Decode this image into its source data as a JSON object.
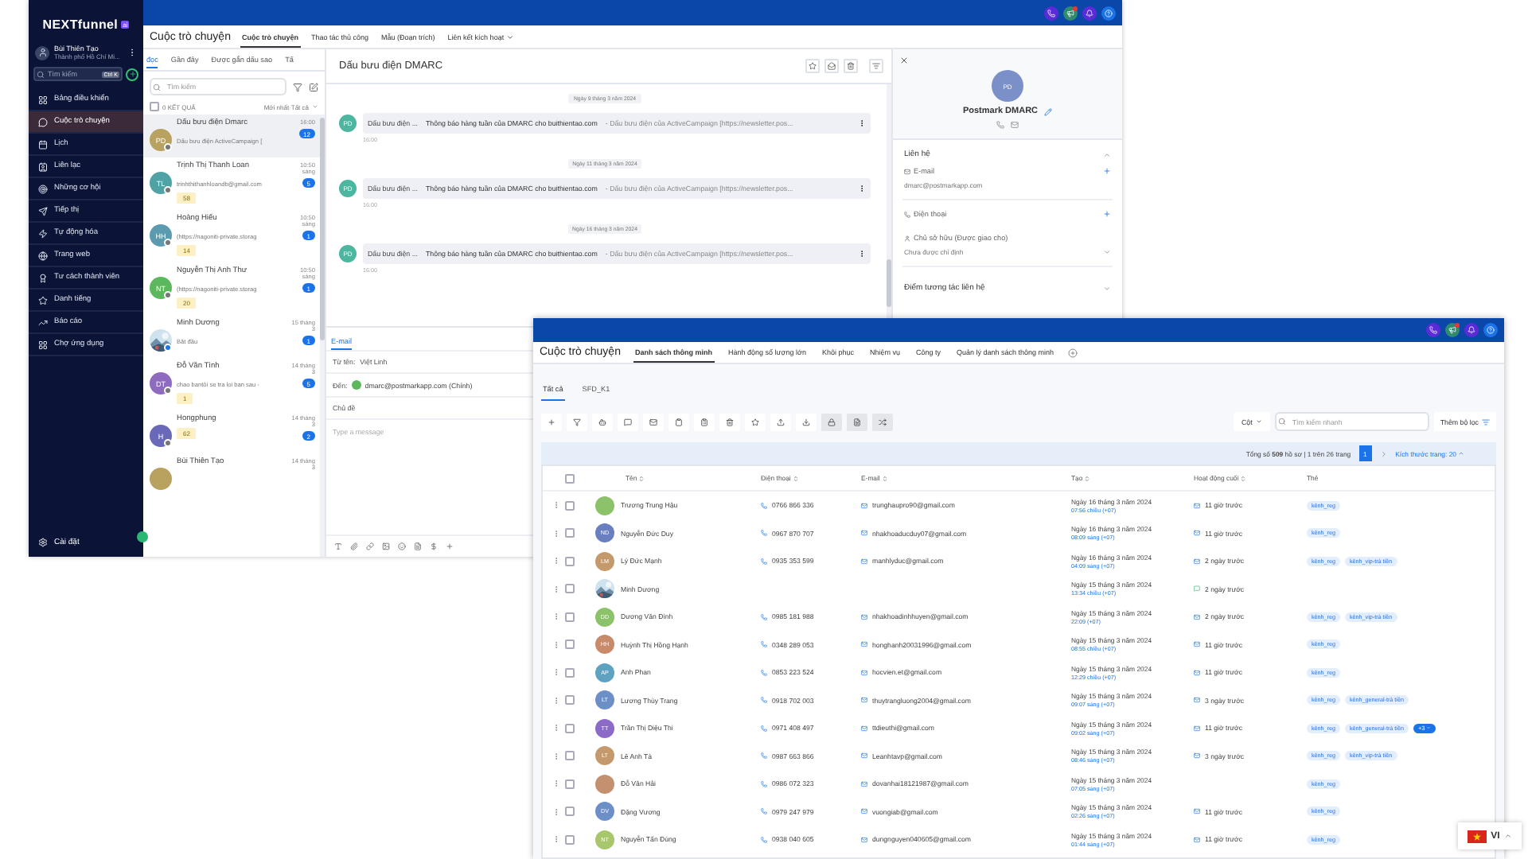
{
  "sidebar": {
    "logo": "NEXTfunnel",
    "logo_badge": "ai",
    "user": {
      "name": "Bùi Thiên Tạo",
      "location": "Thành phố Hồ Chí Mi..."
    },
    "search": {
      "placeholder": "Tìm kiếm",
      "shortcut": "Ctrl K"
    },
    "items": [
      {
        "label": "Bảng điều khiển",
        "selected": false
      },
      {
        "label": "Cuộc trò chuyện",
        "selected": true
      },
      {
        "label": "Lịch",
        "selected": false
      },
      {
        "label": "Liên lạc",
        "selected": false
      },
      {
        "label": "Những cơ hội",
        "selected": false
      },
      {
        "label": "Tiếp thị",
        "selected": false
      },
      {
        "label": "Tự động hóa",
        "selected": false
      },
      {
        "label": "Trang web",
        "selected": false
      },
      {
        "label": "Tư cách thành viên",
        "selected": false
      },
      {
        "label": "Danh tiếng",
        "selected": false
      },
      {
        "label": "Báo cáo",
        "selected": false
      },
      {
        "label": "Chợ ứng dụng",
        "selected": false
      }
    ],
    "settings": "Cài đặt"
  },
  "conversations_window": {
    "page_title": "Cuộc trò chuyện",
    "tabs": [
      {
        "label": "Cuộc trò chuyện",
        "selected": true,
        "dropdown": false
      },
      {
        "label": "Thao tác thủ công",
        "selected": false,
        "dropdown": false
      },
      {
        "label": "Mẫu (Đoạn trích)",
        "selected": false,
        "dropdown": false
      },
      {
        "label": "Liên kết kích hoạt",
        "selected": false,
        "dropdown": true
      }
    ],
    "filters": [
      {
        "label": "đọc",
        "selected": true
      },
      {
        "label": "Gần đây",
        "selected": false
      },
      {
        "label": "Được gắn dấu sao",
        "selected": false
      },
      {
        "label": "Tấ",
        "selected": false
      }
    ],
    "search": {
      "placeholder": "Tìm kiếm"
    },
    "select_all_checked": false,
    "result_count": "0 KẾT QUẢ",
    "sort": "Mới nhất·Tất cả",
    "conversations": [
      {
        "avatar": {
          "kind": "initials",
          "text": "PD",
          "color": "#b9a15f"
        },
        "kind": "email",
        "name": "Dấu bưu điện Dmarc",
        "time": "16:00",
        "snippet": "Dấu bưu điện ActiveCampaign [",
        "unread": "12",
        "selected": true
      },
      {
        "avatar": {
          "kind": "initials",
          "text": "TL",
          "color": "#4fa3a5"
        },
        "kind": "email",
        "name": "Trịnh Thị Thanh Loan",
        "time": "10:50 sáng",
        "snippet": "trinhthithanhloandb@gmail.com",
        "unread": "5",
        "tag": "58",
        "selected": false
      },
      {
        "avatar": {
          "kind": "initials",
          "text": "HH",
          "color": "#5b9bb0"
        },
        "kind": "email",
        "name": "Hoàng Hiếu",
        "time": "10:50 sáng",
        "snippet": "(https://nagoniti-private.storag",
        "unread": "1",
        "tag": "14",
        "selected": false
      },
      {
        "avatar": {
          "kind": "initials",
          "text": "NT",
          "color": "#5cb85c"
        },
        "kind": "email",
        "name": "Nguyễn Thị Anh Thư",
        "time": "10:50 sáng",
        "snippet": "(https://nagoniti-private.storag",
        "unread": "1",
        "tag": "20",
        "selected": false
      },
      {
        "avatar": {
          "kind": "picture"
        },
        "kind": "messenger",
        "name": "Minh Dương",
        "time": "15 tháng 3",
        "snippet": "Bắt đầu",
        "unread": "1",
        "selected": false
      },
      {
        "avatar": {
          "kind": "initials",
          "text": "DT",
          "color": "#8e6bbf"
        },
        "kind": "email",
        "name": "Đỗ Văn Tình",
        "time": "14 tháng 3",
        "snippet": "chao bantôi se tra loi ban sau -",
        "unread": "5",
        "tag": "1",
        "selected": false
      },
      {
        "avatar": {
          "kind": "initials",
          "text": "H",
          "color": "#6a68b8"
        },
        "kind": "email",
        "name": "Hongphung",
        "time": "14 tháng 3",
        "unread": "2",
        "tag": "62",
        "selected": false
      },
      {
        "avatar": {
          "kind": "blank",
          "color": "#b9a15f"
        },
        "name": "Bùi Thiên Tạo",
        "time": "14 tháng 3",
        "selected": false
      }
    ],
    "chat": {
      "title": "Dấu bưu điện DMARC",
      "messages": [
        {
          "date": "Ngày 9 tháng 3 năm 2024",
          "initials": "PD",
          "sender": "Dấu bưu điện ...",
          "subject": "Thông báo hàng tuần của DMARC cho buithientao.com",
          "preview": "- Dấu bưu điện của ActiveCampaign [https://newsletter.pos...",
          "time": "16:00"
        },
        {
          "date": "Ngày 11 tháng 3 năm 2024",
          "initials": "PD",
          "sender": "Dấu bưu điện ...",
          "subject": "Thông báo hàng tuần của DMARC cho buithientao.com",
          "preview": "- Dấu bưu điện của ActiveCampaign [https://newsletter.pos...",
          "time": "16:00"
        },
        {
          "date": "Ngày 16 tháng 3 năm 2024",
          "initials": "PD",
          "sender": "Dấu bưu điện ...",
          "subject": "Thông báo hàng tuần của DMARC cho buithientao.com",
          "preview": "- Dấu bưu điện của ActiveCampaign [https://newsletter.pos...",
          "time": "16:00"
        }
      ],
      "compose": {
        "tab": "E-mail",
        "from_label": "Từ tên:",
        "from": "Việt Linh",
        "to_label": "Đến:",
        "to": "dmarc@postmarkapp.com (Chính)",
        "subject_label": "Chủ đề",
        "placeholder": "Type a message"
      }
    },
    "contact": {
      "initials": "PD",
      "name": "Postmark DMARC",
      "contact_heading": "Liên hệ",
      "email_label": "E-mail",
      "email": "dmarc@postmarkapp.com",
      "phone_label": "Điện thoại",
      "owner_label": "Chủ sở hữu (Được giao cho)",
      "owner_value": "Chưa được chỉ định",
      "engagement_heading": "Điểm tương tác liên hệ"
    }
  },
  "contacts_window": {
    "page_title": "Cuộc trò chuyện",
    "tabs": [
      {
        "label": "Danh sách thông minh",
        "selected": true
      },
      {
        "label": "Hành động số lượng lớn",
        "selected": false
      },
      {
        "label": "Khôi phục",
        "selected": false
      },
      {
        "label": "Nhiệm vụ",
        "selected": false
      },
      {
        "label": "Công ty",
        "selected": false
      },
      {
        "label": "Quản lý danh sách thông minh",
        "selected": false
      }
    ],
    "subtabs": [
      {
        "label": "Tất cả",
        "selected": true
      },
      {
        "label": "SFD_K1",
        "selected": false
      }
    ],
    "columns_button": "Cột",
    "search": {
      "placeholder": "Tìm kiếm nhanh"
    },
    "filter_button": "Thêm bộ lọc",
    "pager": {
      "summary": "Tổng số **509** hồ sơ | 1 trên 26 trang",
      "pages": [
        {
          "label": "1",
          "selected": true
        }
      ],
      "page_size": "Kích thước trang: 20"
    },
    "table": {
      "all_checked": false,
      "columns": [
        "Tên",
        "Điện thoại",
        "E-mail",
        "Tạo",
        "Hoạt động cuối",
        "Thẻ"
      ],
      "rows": [
        {
          "checked": false,
          "avatar": {
            "kind": "blank",
            "color": "#8bc26a"
          },
          "name": "Trương Trung Hậu",
          "phone": "0766 866 336",
          "email": "trunghaupro90@gmail.com",
          "created_date": "Ngày 16 tháng 3 năm 2024",
          "created_time": "07:56 chiều (+07)",
          "activity": {
            "kind": "email",
            "text": "11 giờ trước"
          },
          "tags": [
            "kênh_reg"
          ]
        },
        {
          "checked": false,
          "avatar": {
            "kind": "initials",
            "text": "ND",
            "color": "#6a7fc0"
          },
          "name": "Nguyễn Đức Duy",
          "phone": "0967 870 707",
          "email": "nhakhoaducduy07@gmail.com",
          "created_date": "Ngày 16 tháng 3 năm 2024",
          "created_time": "08:09 sáng (+07)",
          "activity": {
            "kind": "email",
            "text": "11 giờ trước"
          },
          "tags": [
            "kênh_reg"
          ]
        },
        {
          "checked": false,
          "avatar": {
            "kind": "initials",
            "text": "LM",
            "color": "#c49a6c"
          },
          "name": "Lý Đức Mạnh",
          "phone": "0935 353 599",
          "email": "manhlyduc@gmail.com",
          "created_date": "Ngày 16 tháng 3 năm 2024",
          "created_time": "04:09 sáng (+07)",
          "activity": {
            "kind": "email",
            "text": "2 ngày trước"
          },
          "tags": [
            "kênh_reg",
            "kênh_vip-trả tiền"
          ]
        },
        {
          "checked": false,
          "avatar": {
            "kind": "picture"
          },
          "name": "Minh Dương",
          "created_date": "Ngày 15 tháng 3 năm 2024",
          "created_time": "13:34 chiều (+07)",
          "activity": {
            "kind": "chat",
            "text": "2 ngày trước"
          },
          "tags": []
        },
        {
          "checked": false,
          "avatar": {
            "kind": "initials",
            "text": "DD",
            "color": "#8bc26a"
          },
          "name": "Dương Văn Đình",
          "phone": "0985 181 988",
          "email": "nhakhoadinhhuyen@gmail.com",
          "created_date": "Ngày 15 tháng 3 năm 2024",
          "created_time": "22:09 (+07)",
          "activity": {
            "kind": "email",
            "text": "2 ngày trước"
          },
          "tags": [
            "kênh_reg",
            "kênh_vip-trả tiền"
          ]
        },
        {
          "checked": false,
          "avatar": {
            "kind": "initials",
            "text": "HH",
            "color": "#c98a6a"
          },
          "name": "Huỳnh Thị Hồng Hạnh",
          "phone": "0348 289 053",
          "email": "honghanh20031996@gmail.com",
          "created_date": "Ngày 15 tháng 3 năm 2024",
          "created_time": "08:55 chiều (+07)",
          "activity": {
            "kind": "email",
            "text": "11 giờ trước"
          },
          "tags": [
            "kênh_reg"
          ]
        },
        {
          "checked": false,
          "avatar": {
            "kind": "initials",
            "text": "AP",
            "color": "#5ea1c0"
          },
          "name": "Anh Phan",
          "phone": "0853 223 524",
          "email": "hocvien.et@gmail.com",
          "created_date": "Ngày 15 tháng 3 năm 2024",
          "created_time": "12:29 chiều (+07)",
          "activity": {
            "kind": "email",
            "text": "11 giờ trước"
          },
          "tags": [
            "kênh_reg"
          ]
        },
        {
          "checked": false,
          "avatar": {
            "kind": "initials",
            "text": "LT",
            "color": "#6d8fc7"
          },
          "name": "Lương Thùy Trang",
          "phone": "0918 702 003",
          "email": "thuytrangluong2004@gmail.com",
          "created_date": "Ngày 15 tháng 3 năm 2024",
          "created_time": "09:07 sáng (+07)",
          "activity": {
            "kind": "email",
            "text": "3 ngày trước"
          },
          "tags": [
            "kênh_reg",
            "kênh_general-trả tiền"
          ]
        },
        {
          "checked": false,
          "avatar": {
            "kind": "initials",
            "text": "TT",
            "color": "#8b6bc7"
          },
          "name": "Trần Thị Diệu Thi",
          "phone": "0971 408 497",
          "email": "ttdieuthi@gmail.com",
          "created_date": "Ngày 15 tháng 3 năm 2024",
          "created_time": "09:02 sáng (+07)",
          "activity": {
            "kind": "email",
            "text": "11 giờ trước"
          },
          "tags": [
            "kênh_reg",
            "kênh_general-trả tiền"
          ],
          "more": "+3"
        },
        {
          "checked": false,
          "avatar": {
            "kind": "initials",
            "text": "LT",
            "color": "#c49a6c"
          },
          "name": "Lê Anh Tà",
          "phone": "0987 663 866",
          "email": "Leanhtavp@gmail.com",
          "created_date": "Ngày 15 tháng 3 năm 2024",
          "created_time": "08:46 sáng (+07)",
          "activity": {
            "kind": "email",
            "text": "3 ngày trước"
          },
          "tags": [
            "kênh_reg",
            "kênh_vip-trả tiền"
          ]
        },
        {
          "checked": false,
          "avatar": {
            "kind": "blank",
            "color": "#c49070"
          },
          "name": "Đỗ Văn Hải",
          "phone": "0986 072 323",
          "email": "dovanhai18121987@gmail.com",
          "created_date": "Ngày 15 tháng 3 năm 2024",
          "created_time": "07:05 sáng (+07)",
          "tags": [
            "kênh_reg"
          ]
        },
        {
          "checked": false,
          "avatar": {
            "kind": "initials",
            "text": "DV",
            "color": "#6d8fc7"
          },
          "name": "Đặng Vương",
          "phone": "0979 247 979",
          "email": "vuongiab@gmail.com",
          "created_date": "Ngày 15 tháng 3 năm 2024",
          "created_time": "02:26 sáng (+07)",
          "activity": {
            "kind": "email",
            "text": "11 giờ trước"
          },
          "tags": [
            "kênh_reg"
          ]
        },
        {
          "checked": false,
          "avatar": {
            "kind": "initials",
            "text": "NT",
            "color": "#a8c66c"
          },
          "name": "Nguyễn Tấn Đúng",
          "phone": "0938 040 605",
          "email": "dungnguyen040605@gmail.com",
          "created_date": "Ngày 15 tháng 3 năm 2024",
          "created_time": "01:44 sáng (+07)",
          "activity": {
            "kind": "email",
            "text": "11 giờ trước"
          },
          "tags": [
            "kênh_reg"
          ]
        }
      ]
    }
  },
  "language": "VI"
}
